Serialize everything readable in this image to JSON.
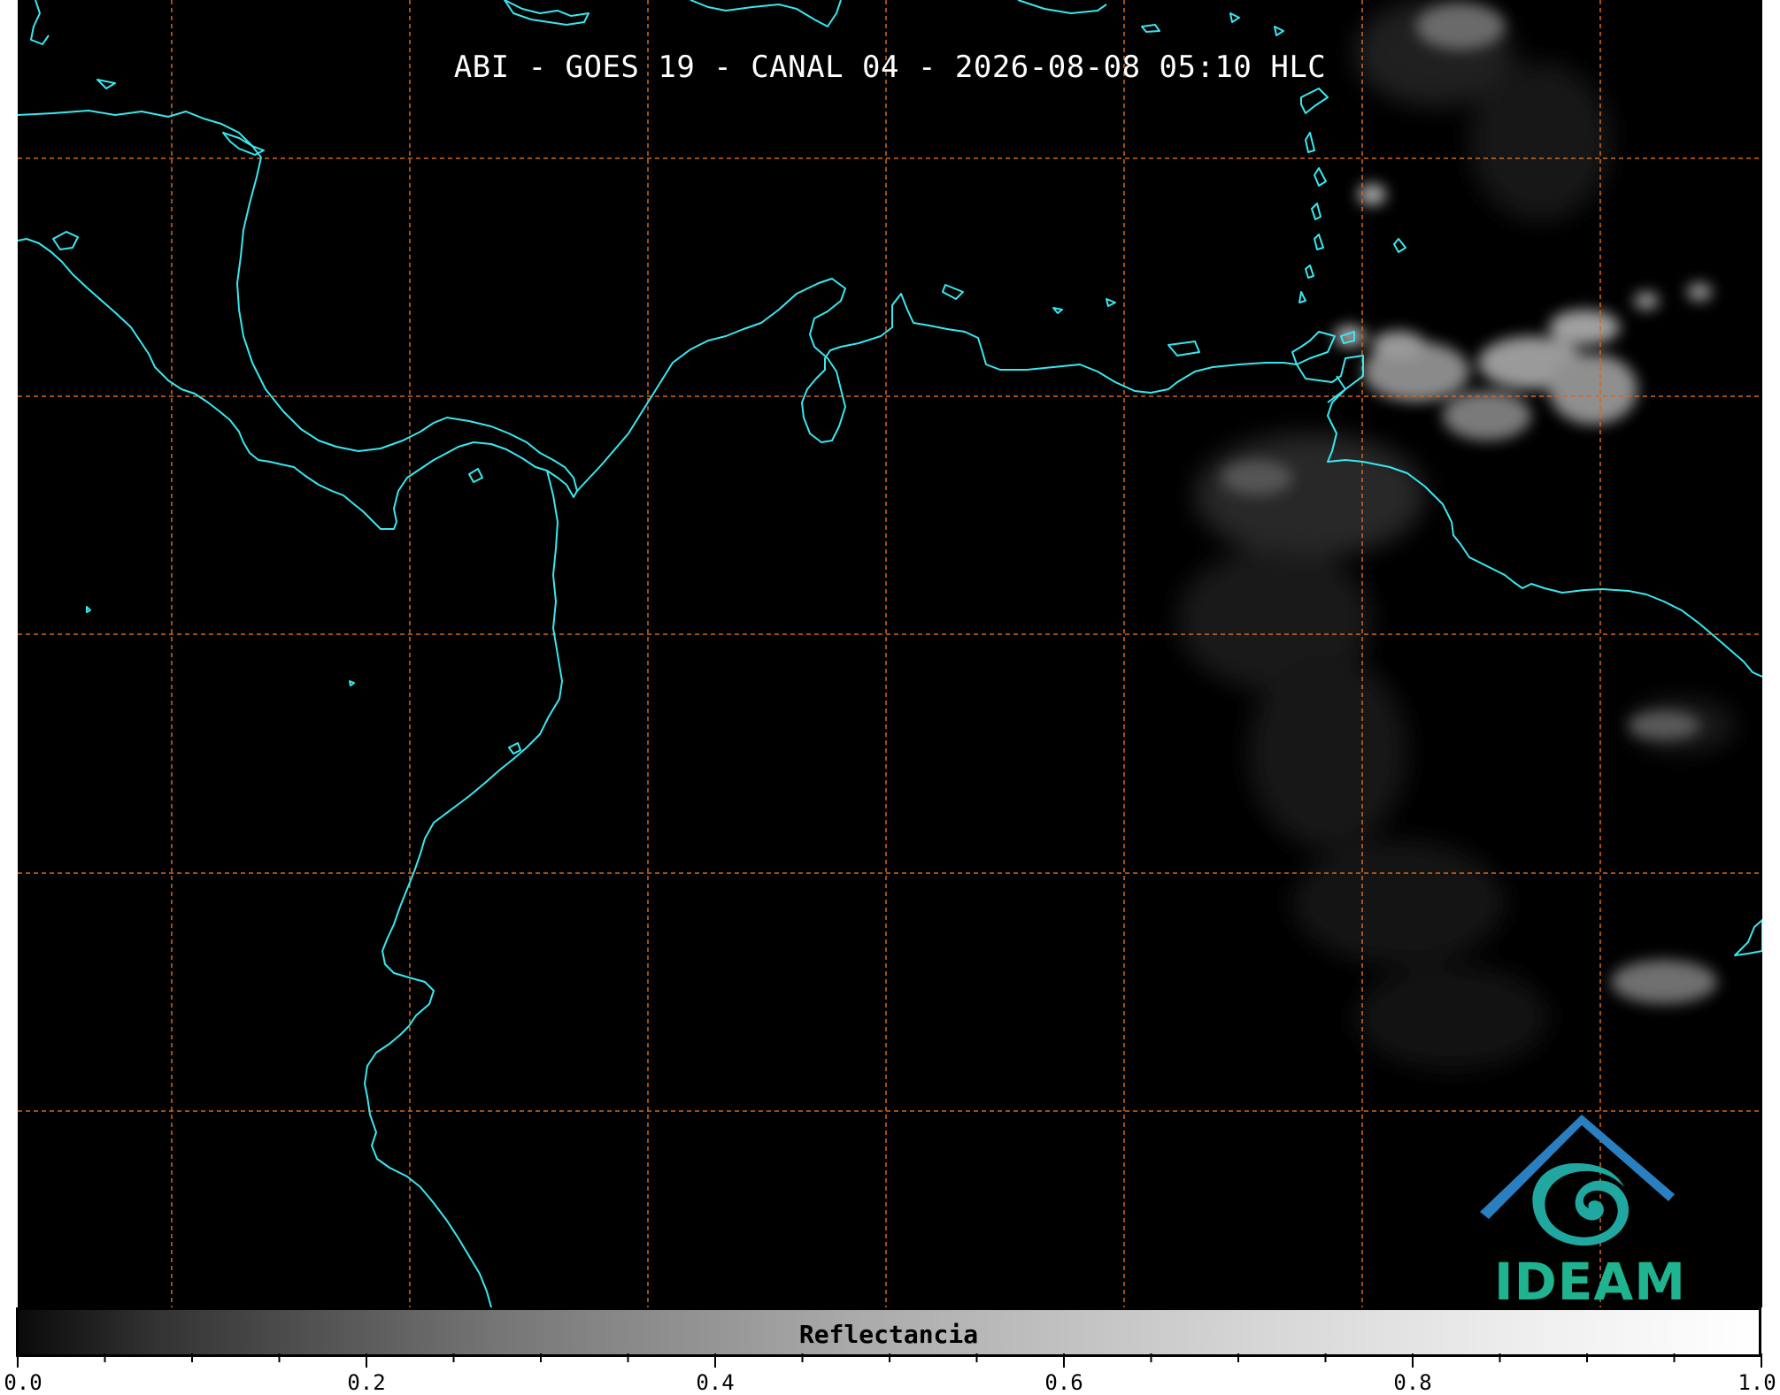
{
  "map": {
    "title": "ABI - GOES 19 - CANAL 04 - 2026-08-08 05:10 HLC",
    "background_color": "#000000",
    "coastline_color": "#38e8f0",
    "gridline_color": "#d2691e",
    "gridline_style": "dashed"
  },
  "logo": {
    "text": "IDEAM",
    "text_color": "#1fb38f",
    "roof_color": "#2a7fc0",
    "swirl_color": "#20a8a0"
  },
  "colorbar": {
    "label": "Reflectancia",
    "range": [
      0.0,
      1.0
    ],
    "tick_labels": [
      "0.0",
      "0.2",
      "0.4",
      "0.6",
      "0.8",
      "1.0"
    ],
    "colormap": "grayscale"
  }
}
